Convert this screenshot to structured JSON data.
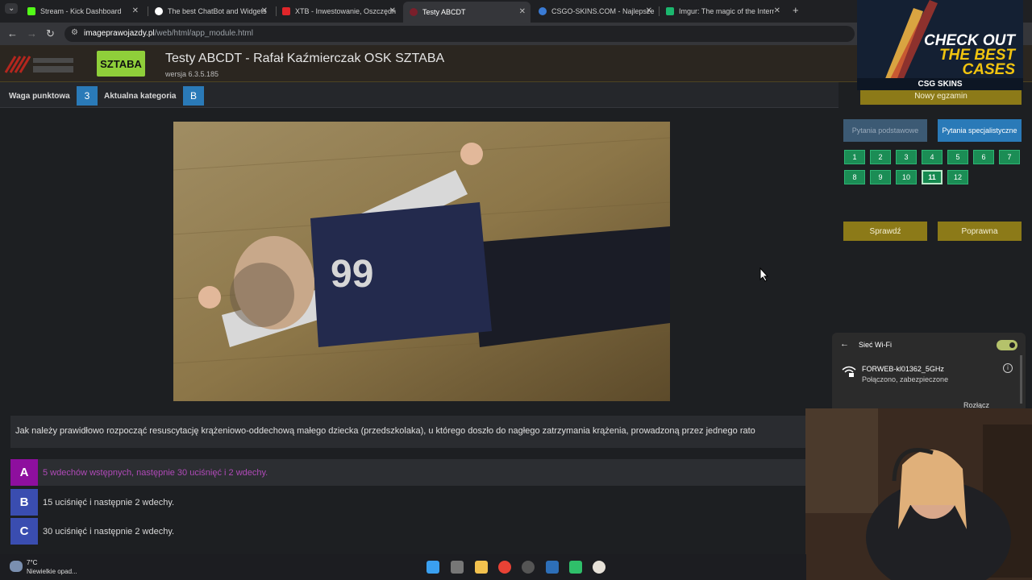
{
  "browser": {
    "tabs": [
      {
        "title": "Stream - Kick Dashboard"
      },
      {
        "title": "The best ChatBot and Widgets"
      },
      {
        "title": "XTB - Inwestowanie, Oszczędn"
      },
      {
        "title": "Testy ABCDT"
      },
      {
        "title": "CSGO-SKINS.COM - Najlepsze"
      },
      {
        "title": "Imgur: The magic of the Interne"
      }
    ],
    "active_tab": "Testy ABCDT",
    "url_host": "imageprawojazdy.pl",
    "url_path": "/web/html/app_module.html"
  },
  "header": {
    "title": "Testy ABCDT - Rafał Kaźmierczak OSK SZTABA",
    "version": "wersja 6.3.5.185",
    "logo_right_text": "SZTABA"
  },
  "subbar": {
    "weight_label": "Waga punktowa",
    "weight_value": "3",
    "category_label": "Aktualna kategoria",
    "category_value": "B"
  },
  "question": {
    "text": "Jak należy prawidłowo rozpocząć resuscytację krążeniowo-oddechową małego dziecka (przedszkolaka), u którego doszło do nagłego zatrzymania krążenia, prowadzoną przez jednego rato",
    "answers": [
      {
        "letter": "A",
        "text": "5 wdechów wstępnych, następnie 30 uciśnięć i 2 wdechy."
      },
      {
        "letter": "B",
        "text": "15 uciśnięć i następnie 2 wdechy."
      },
      {
        "letter": "C",
        "text": "30 uciśnięć i następnie 2 wdechy."
      }
    ],
    "selected": "A"
  },
  "panel": {
    "new_exam": "Nowy egzamin",
    "basic_questions": "Pytania podstawowe",
    "special_questions": "Pytania specjalistyczne",
    "numbers": [
      "1",
      "2",
      "3",
      "4",
      "5",
      "6",
      "7",
      "8",
      "9",
      "10",
      "11",
      "12"
    ],
    "current_number": "11",
    "check_button": "Sprawdź",
    "correct_button": "Poprawna"
  },
  "ad": {
    "line1": "CHECK OUT",
    "line2": "THE BEST",
    "line3": "CASES",
    "brand": "CSG SKINS"
  },
  "wifi": {
    "title": "Sieć Wi-Fi",
    "ssid": "FORWEB-kl01362_5GHz",
    "status": "Połączono, zabezpieczone",
    "disconnect": "Rozłącz"
  },
  "taskbar": {
    "weather_temp": "7°C",
    "weather_desc": "Niewielkie opad..."
  },
  "colors": {
    "accent_gold": "#8c7a18",
    "accent_blue": "#2a7ab8",
    "number_green": "#1b8d55",
    "answer_purple": "#8e0f9e",
    "answer_indigo": "#3a4db0"
  }
}
